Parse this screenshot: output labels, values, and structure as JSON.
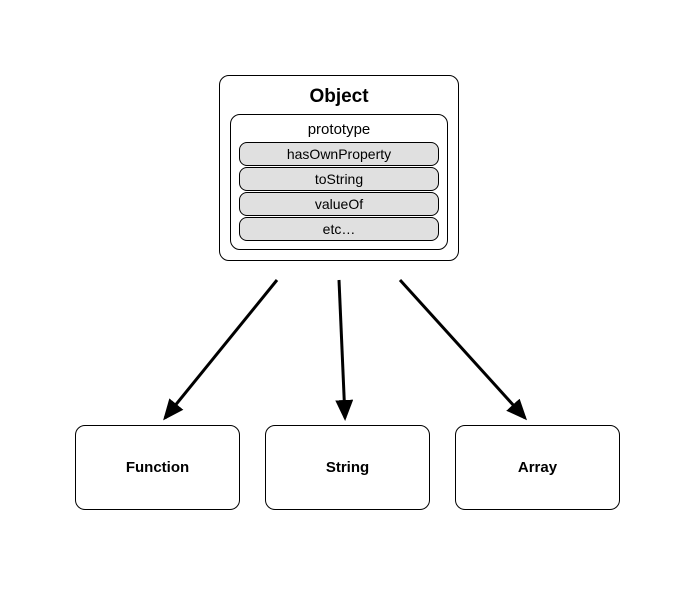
{
  "parent": {
    "title": "Object",
    "prototype_label": "prototype",
    "methods": [
      "hasOwnProperty",
      "toString",
      "valueOf",
      "etc…"
    ]
  },
  "children": [
    "Function",
    "String",
    "Array"
  ]
}
